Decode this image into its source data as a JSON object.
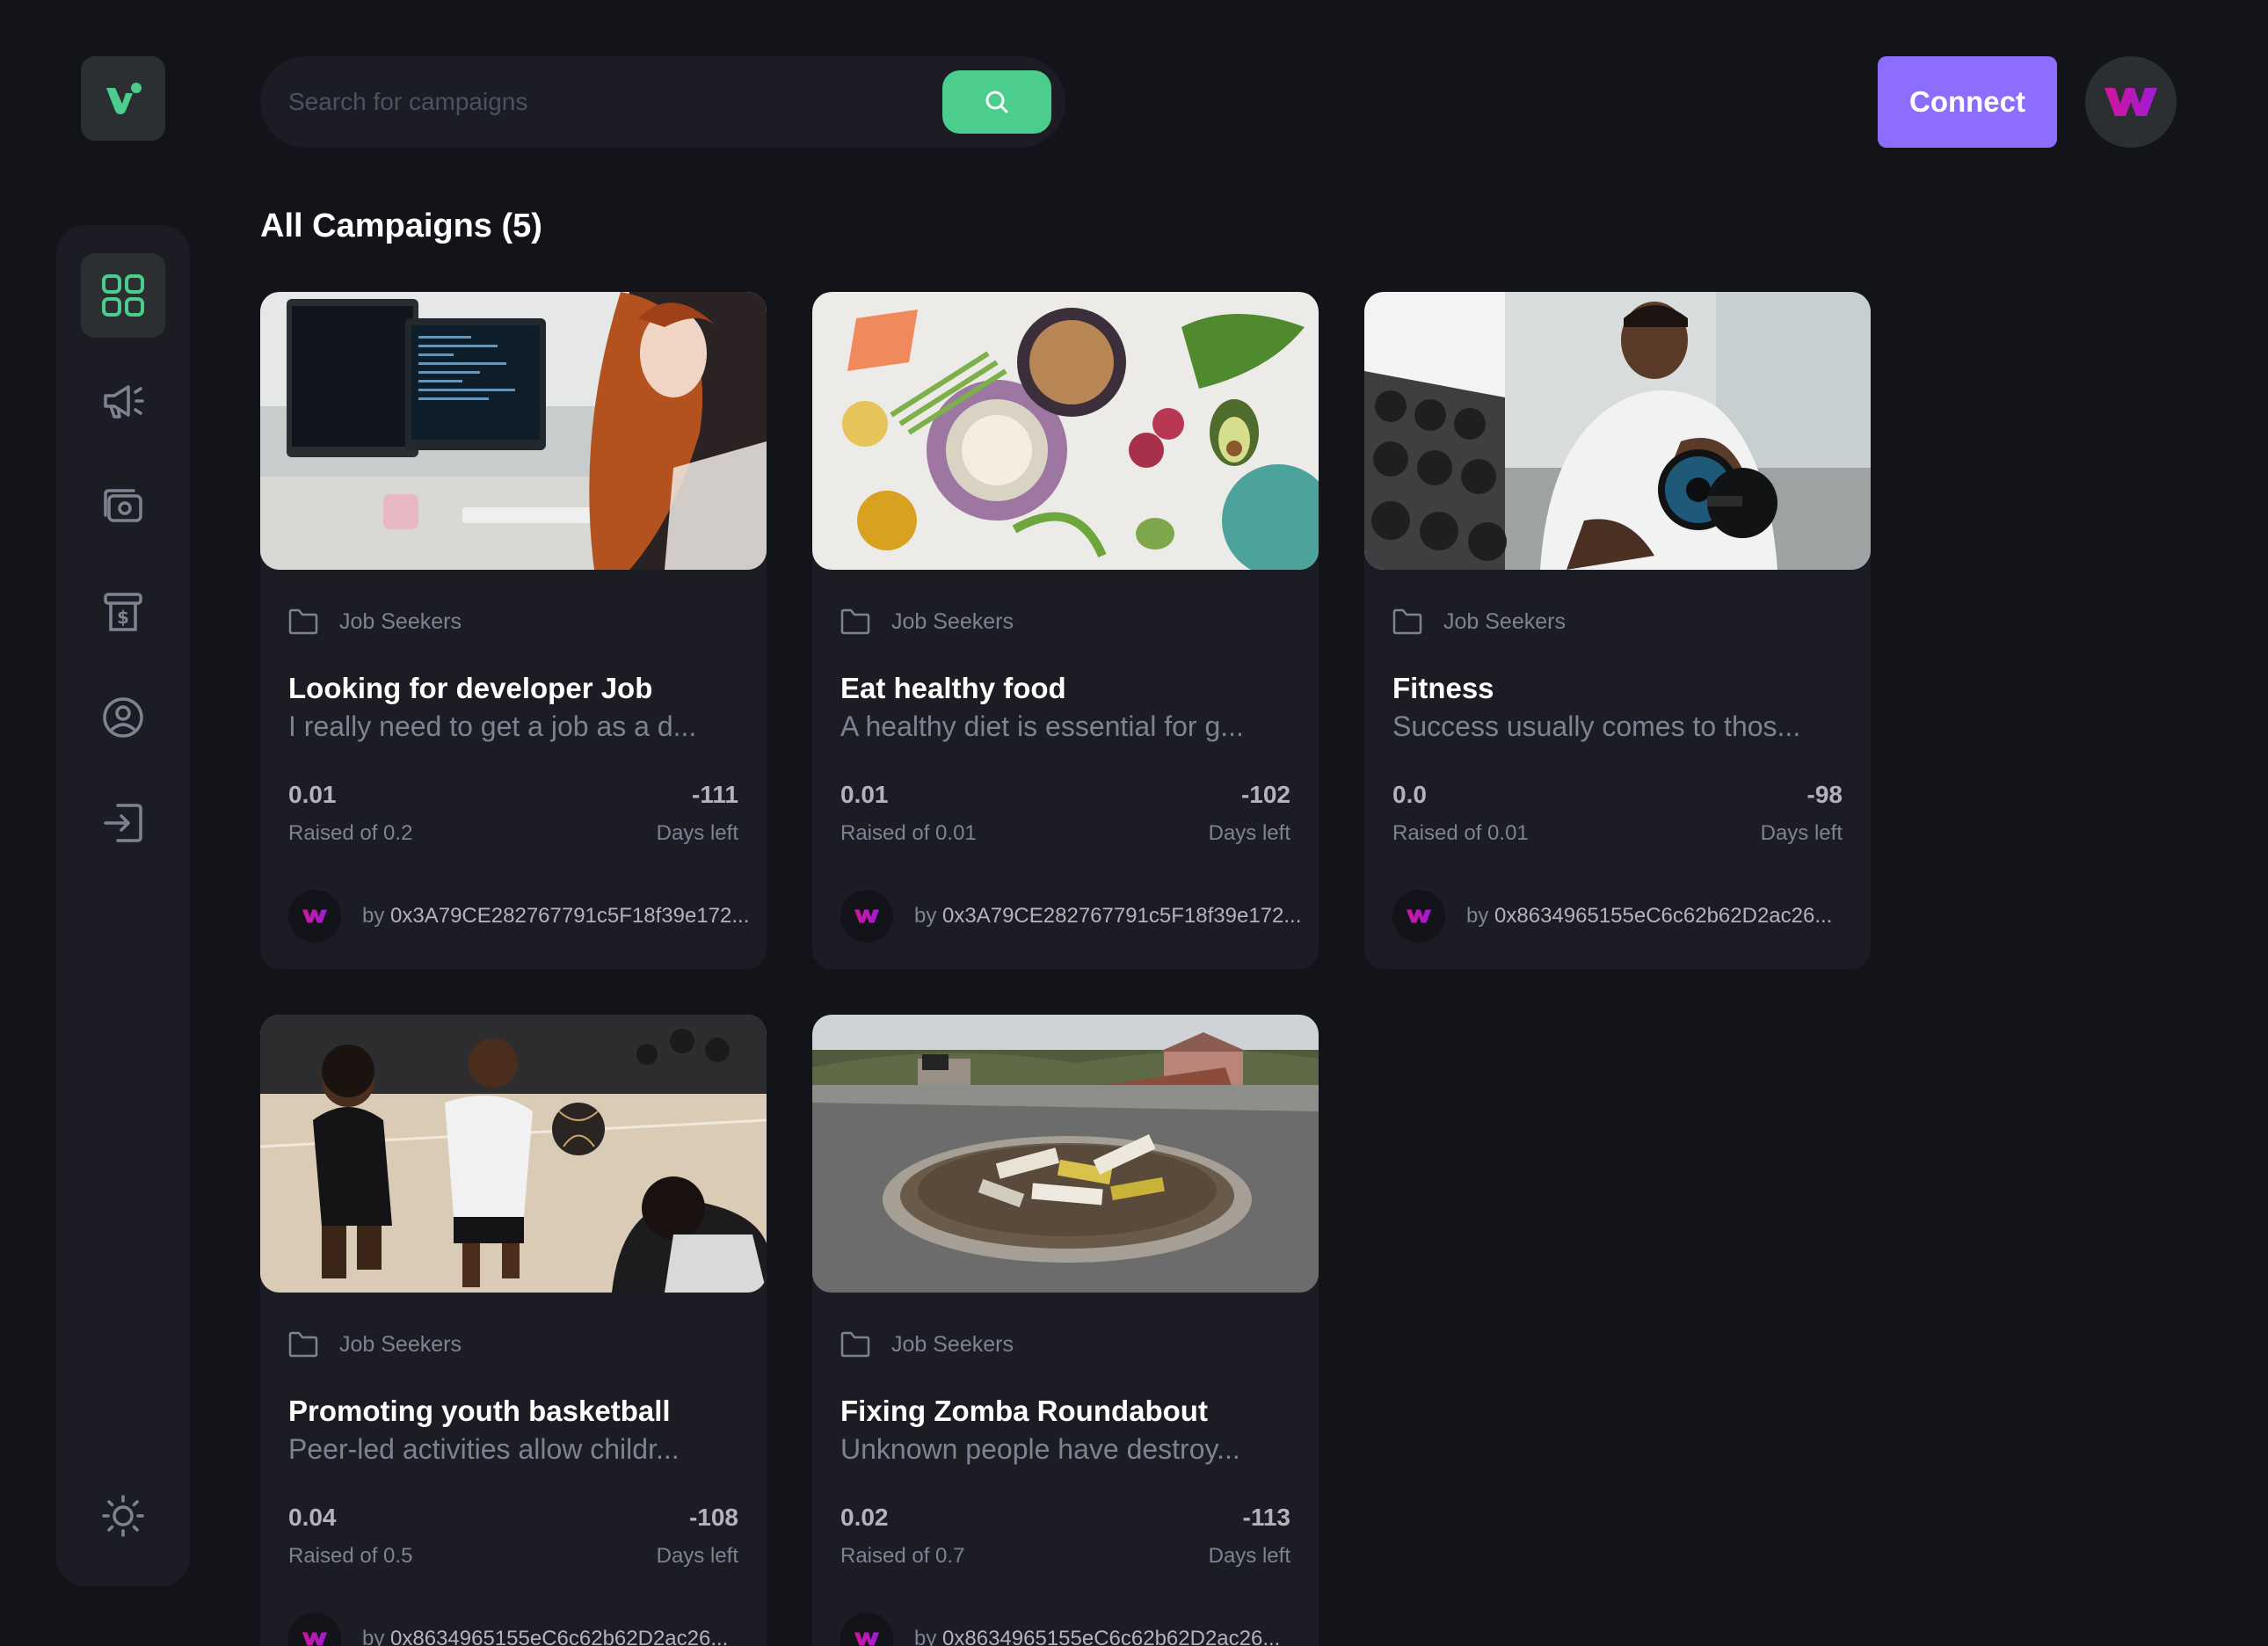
{
  "search": {
    "placeholder": "Search for campaigns"
  },
  "header": {
    "connect_label": "Connect"
  },
  "main": {
    "heading": "All Campaigns (5)"
  },
  "colors": {
    "background": "#13131a",
    "panel": "#1c1c24",
    "accent_green": "#4acd8d",
    "accent_purple": "#8c6dfd",
    "brand_magenta": "#c41ab5"
  },
  "campaigns": [
    {
      "category": "Job Seekers",
      "title": "Looking for developer Job",
      "description": "I really need to get a job as a d...",
      "raised": "0.01",
      "raised_label": "Raised of 0.2",
      "days": "-111",
      "days_label": "Days left",
      "by": "by",
      "owner": "0x3A79CE282767791c5F18f39e172...",
      "image": "office-developer-photo"
    },
    {
      "category": "Job Seekers",
      "title": "Eat healthy food",
      "description": "A healthy diet is essential for g...",
      "raised": "0.01",
      "raised_label": "Raised of 0.01",
      "days": "-102",
      "days_label": "Days left",
      "by": "by",
      "owner": "0x3A79CE282767791c5F18f39e172...",
      "image": "healthy-food-photo"
    },
    {
      "category": "Job Seekers",
      "title": "Fitness",
      "description": "Success usually comes to thos...",
      "raised": "0.0",
      "raised_label": "Raised of 0.01",
      "days": "-98",
      "days_label": "Days left",
      "by": "by",
      "owner": "0x8634965155eC6c62b62D2ac26...",
      "image": "gym-dumbbell-photo"
    },
    {
      "category": "Job Seekers",
      "title": "Promoting youth basketball",
      "description": "Peer-led activities allow childr...",
      "raised": "0.04",
      "raised_label": "Raised of 0.5",
      "days": "-108",
      "days_label": "Days left",
      "by": "by",
      "owner": "0x8634965155eC6c62b62D2ac26...",
      "image": "youth-basketball-photo"
    },
    {
      "category": "Job Seekers",
      "title": "Fixing Zomba Roundabout",
      "description": "Unknown people have destroy...",
      "raised": "0.02",
      "raised_label": "Raised of 0.7",
      "days": "-113",
      "days_label": "Days left",
      "by": "by",
      "owner": "0x8634965155eC6c62b62D2ac26...",
      "image": "broken-roundabout-photo"
    }
  ]
}
